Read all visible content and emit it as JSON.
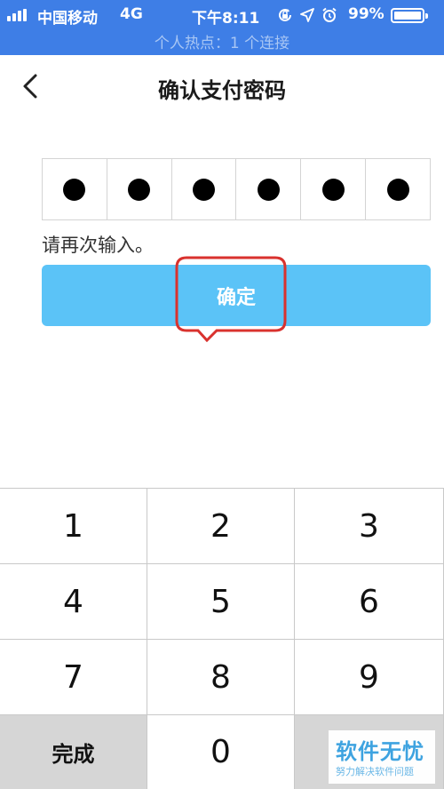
{
  "status_bar": {
    "carrier": "中国移动",
    "network": "4G",
    "time": "下午8:11",
    "battery": "99%",
    "hotspot": "个人热点：1 个连接",
    "icons": [
      "signal-icon",
      "orientation-lock-icon",
      "location-icon",
      "alarm-icon",
      "battery-icon"
    ]
  },
  "nav": {
    "back_icon": "chevron-left-icon",
    "title": "确认支付密码"
  },
  "pin": {
    "length": 6,
    "entered": 6
  },
  "hint": "请再次输入。",
  "confirm_label": "确定",
  "callout_color": "#d9322e",
  "accent": "#5bc3f7",
  "keypad": {
    "keys": [
      "1",
      "2",
      "3",
      "4",
      "5",
      "6",
      "7",
      "8",
      "9",
      "完成",
      "0",
      ""
    ]
  },
  "watermark": {
    "main": "软件无忧",
    "sub": "努力解决软件问题"
  }
}
